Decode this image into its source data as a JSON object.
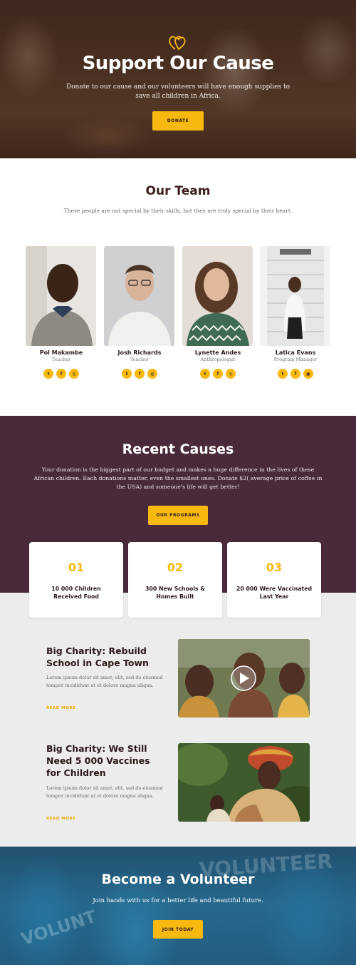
{
  "hero": {
    "title": "Support Our Cause",
    "subtitle": "Donate to our cause and our volunteers will have enough supplies to save all children in Africa.",
    "button": "DONATE",
    "icon": "hearts-icon"
  },
  "team": {
    "title": "Our Team",
    "subtitle": "These people are not special by their skills, but they are truly special by their heart.",
    "members": [
      {
        "name": "Pol Makambe",
        "role": "Teacher",
        "socials": [
          "t",
          "f",
          "ig"
        ]
      },
      {
        "name": "Josh Richards",
        "role": "Teacher",
        "socials": [
          "t",
          "f",
          "dr"
        ]
      },
      {
        "name": "Lynette Andes",
        "role": "Anthropologist",
        "socials": [
          "t",
          "f",
          "ig"
        ]
      },
      {
        "name": "Latica Evans",
        "role": "Program Manager",
        "socials": [
          "t",
          "f",
          "in"
        ]
      }
    ]
  },
  "causes": {
    "title": "Recent Causes",
    "text": "Your donation is the biggest part of our budget and makes a huge difference in the lives of these African children. Each donations matter, even the smallest ones. Donate $2( average price of coffee in the USA) and someone's life will get better!",
    "button": "OUR PROGRAMS",
    "stats": [
      {
        "num": "01",
        "label": "10 000 Children Received Food"
      },
      {
        "num": "02",
        "label": "300 New Schools & Homes Built"
      },
      {
        "num": "03",
        "label": "20 000 Were Vaccinated Last Year"
      }
    ]
  },
  "posts": [
    {
      "title": "Big Charity: Rebuild School in Cape Town",
      "text": "Lorem ipsum dolor sit amet, elit, sed do eiusmod tempor incididunt ut et dolore magna aliqua.",
      "link": "READ MORE"
    },
    {
      "title": "Big Charity: We Still Need 5 000 Vaccines for Children",
      "text": "Lorem ipsum dolor sit amet, elit, sed do eiusmod tempor incididunt ut et dolore magna aliqua.",
      "link": "READ MORE"
    }
  ],
  "volunteer": {
    "title": "Become a Volunteer",
    "subtitle": "Join hands with us for a better life and beautiful future.",
    "button": "JOIN TODAY"
  },
  "colors": {
    "accent": "#f7b90f",
    "plum": "#4a2a3a",
    "dark_text": "#3b1e1e"
  }
}
